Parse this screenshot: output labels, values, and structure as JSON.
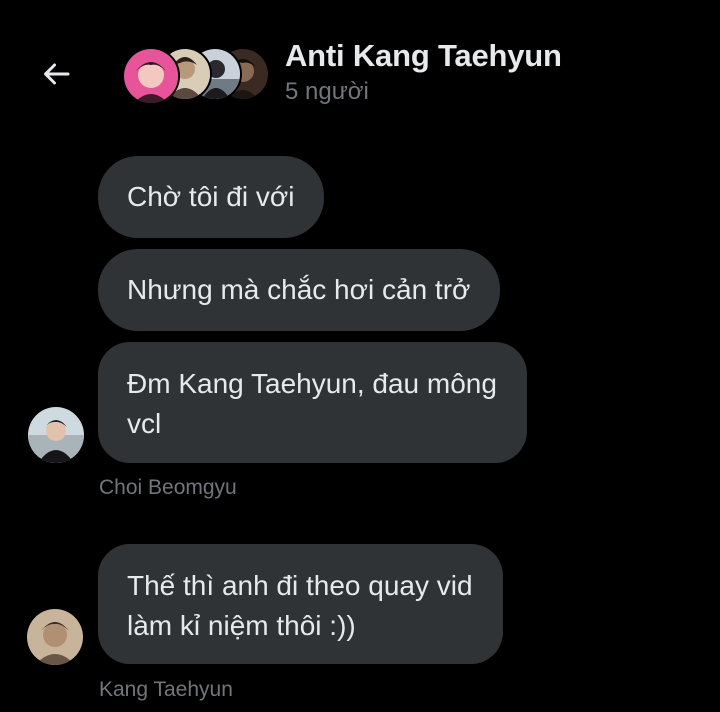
{
  "header": {
    "title": "Anti Kang Taehyun",
    "subtitle": "5 người",
    "back_icon": "arrow-left-icon",
    "avatars": [
      "group-member-avatar-1",
      "group-member-avatar-2",
      "group-member-avatar-3",
      "group-member-avatar-4"
    ]
  },
  "messages": [
    {
      "text": "Chờ tôi đi với"
    },
    {
      "text": "Nhưng mà chắc hơi cản trở"
    },
    {
      "line1": "Đm Kang Taehyun, đau mông",
      "line2": "vcl",
      "sender": "Choi Beomgyu"
    },
    {
      "line1": "Thế thì anh đi theo quay vid",
      "line2": "làm kỉ niệm thôi :))",
      "sender": "Kang Taehyun"
    }
  ],
  "colors": {
    "background": "#000000",
    "bubble": "#2f3336",
    "text": "#e7e9ea",
    "muted": "#71767b"
  }
}
